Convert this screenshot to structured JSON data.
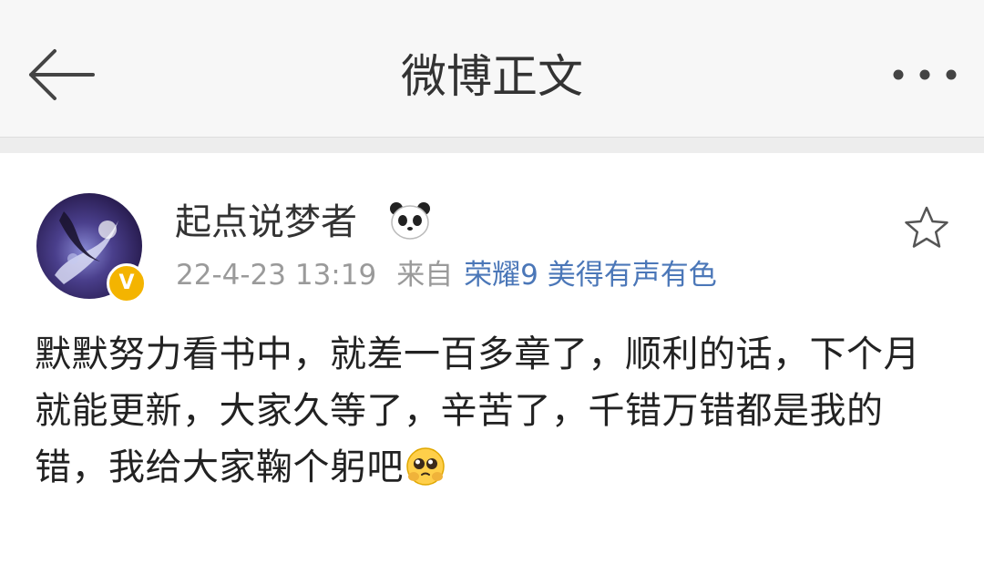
{
  "header": {
    "title": "微博正文"
  },
  "post": {
    "author": "起点说梦者",
    "timestamp": "22-4-23 13:19",
    "from_label": "来自",
    "source": "荣耀9 美得有声有色",
    "text": "默默努力看书中，就差一百多章了，顺利的话，下个月就能更新，大家久等了，辛苦了，千错万错都是我的错，我给大家鞠个躬吧",
    "verified_badge": "V"
  },
  "icons": {
    "back": "arrow-left-icon",
    "more": "more-dots-icon",
    "star": "star-outline-icon",
    "panda": "panda-icon",
    "emoji": "pleading-face-emoji-icon"
  },
  "colors": {
    "header_bg": "#f7f7f7",
    "link": "#4b77b8",
    "meta": "#9a9a9a",
    "badge": "#f4b400"
  }
}
